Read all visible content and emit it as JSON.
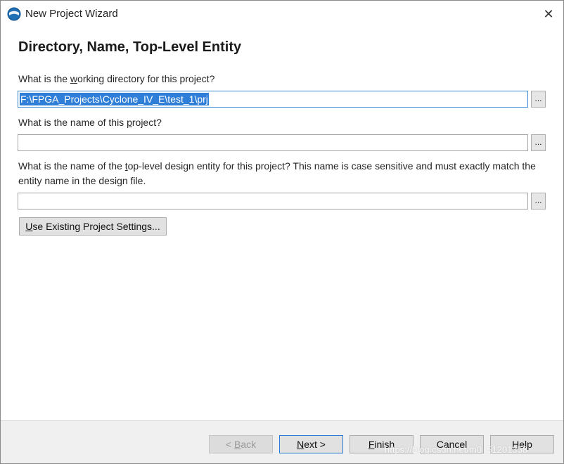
{
  "window": {
    "title": "New Project Wizard",
    "close_glyph": "✕",
    "icon": "quartus-globe-icon"
  },
  "page": {
    "heading": "Directory, Name, Top-Level Entity"
  },
  "fields": {
    "working_dir": {
      "label_pre": "What is the ",
      "label_ul": "w",
      "label_post": "orking directory for this project?",
      "value": "F:\\FPGA_Projects\\Cyclone_IV_E\\test_1\\prj",
      "browse_label": "..."
    },
    "project_name": {
      "label_pre": "What is the name of this ",
      "label_ul": "p",
      "label_post": "roject?",
      "value": "",
      "browse_label": "..."
    },
    "top_entity": {
      "label_pre": "What is the name of the ",
      "label_ul": "t",
      "label_post": "op-level design entity for this project? This name is case sensitive and must exactly match the entity name in the design file.",
      "value": "",
      "browse_label": "..."
    }
  },
  "buttons": {
    "use_existing": {
      "ul": "U",
      "rest": "se Existing Project Settings..."
    },
    "back": {
      "pre": "< ",
      "ul": "B",
      "rest": "ack"
    },
    "next": {
      "pre": "",
      "ul": "N",
      "rest": "ext >"
    },
    "finish": {
      "pre": "",
      "ul": "F",
      "rest": "inish"
    },
    "cancel": {
      "label": "Cancel"
    },
    "help": {
      "pre": "",
      "ul": "H",
      "rest": "elp"
    }
  },
  "watermark": "https://blog.csdn.net/m0_51201358",
  "colors": {
    "selection": "#2f7ed8",
    "focus_border": "#3a8ad6",
    "panel_bg": "#ffffff",
    "footer_bg": "#f0f0f0"
  }
}
